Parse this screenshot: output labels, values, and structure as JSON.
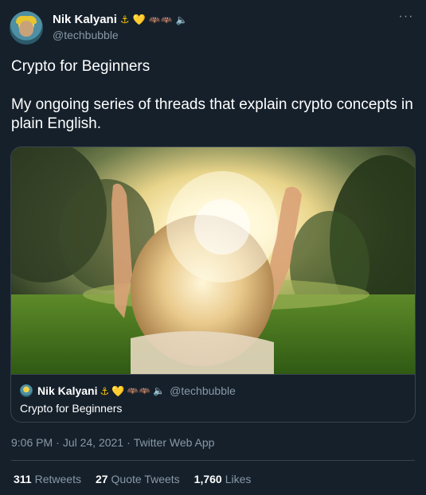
{
  "author": {
    "display_name": "Nik Kalyani",
    "handle": "@techbubble",
    "emojis": [
      "⚓",
      "💛",
      "🦇🦇",
      "🔈"
    ]
  },
  "tweet": {
    "text": "Crypto for Beginners\n\nMy ongoing series of threads that explain crypto concepts in plain English."
  },
  "quoted": {
    "display_name": "Nik Kalyani",
    "handle": "@techbubble",
    "text": "Crypto for Beginners"
  },
  "meta": {
    "time": "9:06 PM",
    "separator": "·",
    "date": "Jul 24, 2021",
    "app": "Twitter Web App"
  },
  "stats": {
    "retweets_count": "311",
    "retweets_label": "Retweets",
    "quotes_count": "27",
    "quotes_label": "Quote Tweets",
    "likes_count": "1,760",
    "likes_label": "Likes"
  },
  "more_icon": "more-horizontal-icon",
  "colors": {
    "background": "#15202b",
    "text_primary": "#ffffff",
    "text_secondary": "#8899a6",
    "border": "#38444d"
  }
}
